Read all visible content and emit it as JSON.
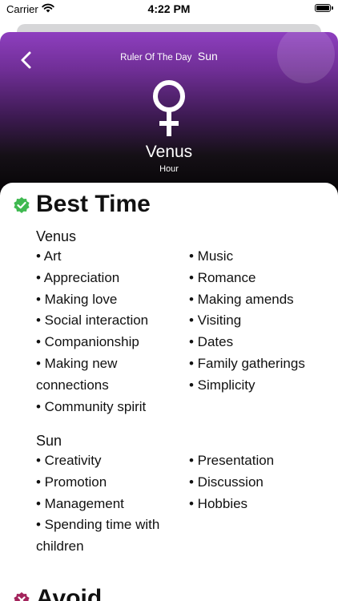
{
  "status_bar": {
    "carrier": "Carrier",
    "time": "4:22 PM"
  },
  "header": {
    "ruler_label": "Ruler Of The Day",
    "ruler_value": "Sun",
    "planet_name": "Venus",
    "planet_sub": "Hour",
    "symbol_icon": "venus-symbol-icon",
    "gradient_top": "#8e3fbf",
    "gradient_bottom": "#000000"
  },
  "best_time": {
    "title": "Best Time",
    "icon": "check-badge-icon",
    "icon_color": "#3fb950",
    "groups": [
      {
        "name": "Venus",
        "left": [
          "• Art",
          "• Appreciation",
          "• Making love",
          "• Social interaction",
          "• Companionship",
          "• Making new connections",
          "• Community spirit"
        ],
        "right": [
          "• Music",
          "• Romance",
          "• Making amends",
          "• Visiting",
          "• Dates",
          "• Family gatherings",
          "• Simplicity"
        ]
      },
      {
        "name": "Sun",
        "left": [
          "• Creativity",
          "• Promotion",
          "• Management",
          "• Spending time with children"
        ],
        "right": [
          "• Presentation",
          "• Discussion",
          "• Hobbies"
        ]
      }
    ]
  },
  "avoid": {
    "title": "Avoid",
    "icon": "avoid-badge-icon",
    "icon_color": "#a3245c"
  }
}
